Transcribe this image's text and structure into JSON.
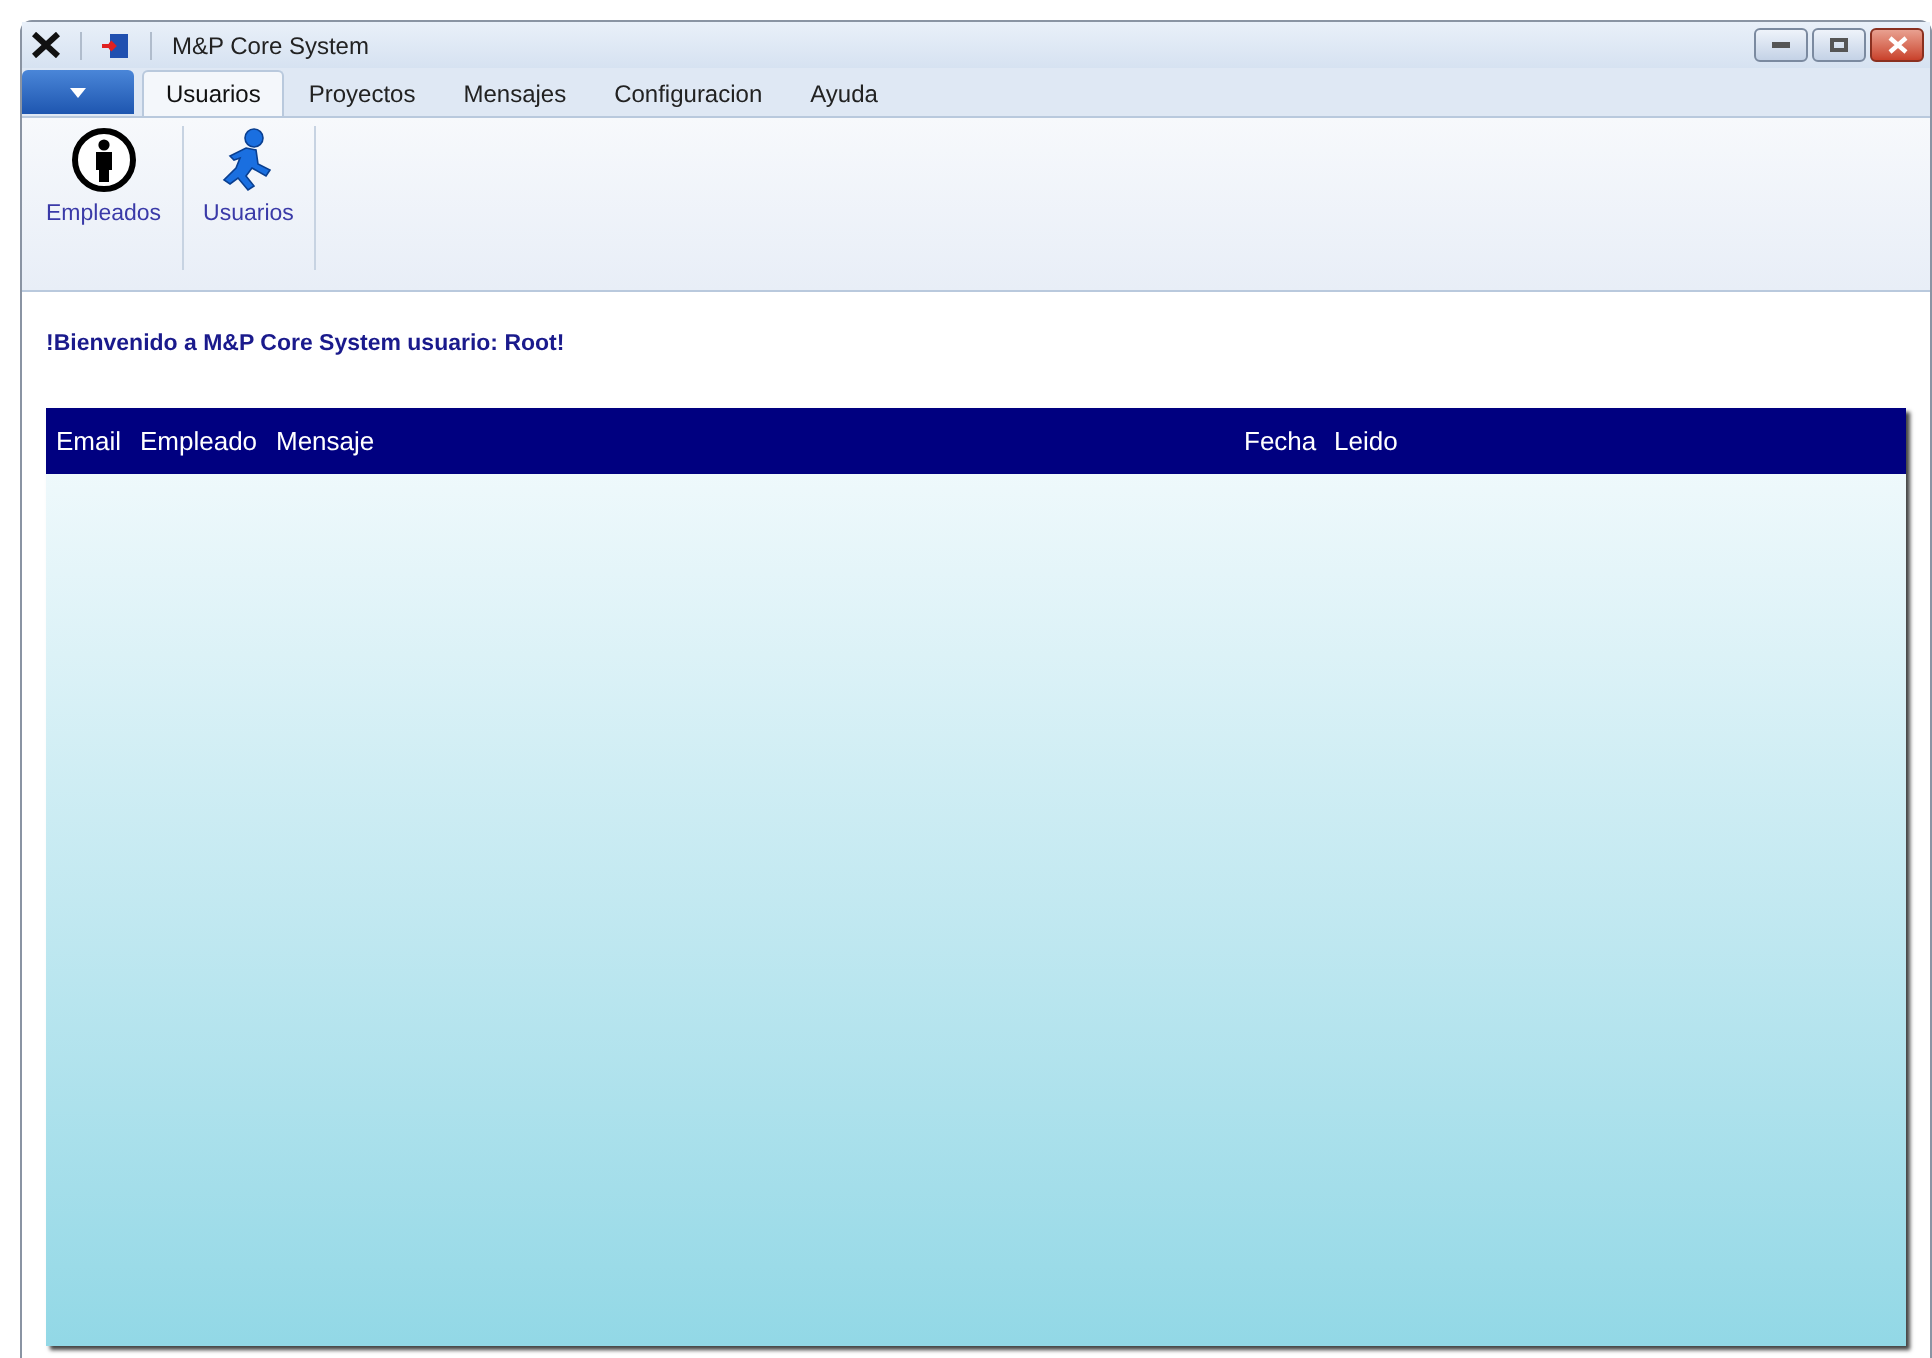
{
  "window": {
    "title": "M&P Core System"
  },
  "tabs": [
    {
      "label": "Usuarios",
      "selected": true
    },
    {
      "label": "Proyectos",
      "selected": false
    },
    {
      "label": "Mensajes",
      "selected": false
    },
    {
      "label": "Configuracion",
      "selected": false
    },
    {
      "label": "Ayuda",
      "selected": false
    }
  ],
  "ribbon": {
    "buttons": [
      {
        "label": "Empleados",
        "kind": "info"
      },
      {
        "label": "Usuarios",
        "kind": "runner"
      }
    ]
  },
  "welcome": "!Bienvenido a M&P Core System usuario: Root!",
  "table": {
    "columns": [
      "Email",
      "Empleado",
      "Mensaje",
      "Fecha",
      "Leido"
    ]
  }
}
